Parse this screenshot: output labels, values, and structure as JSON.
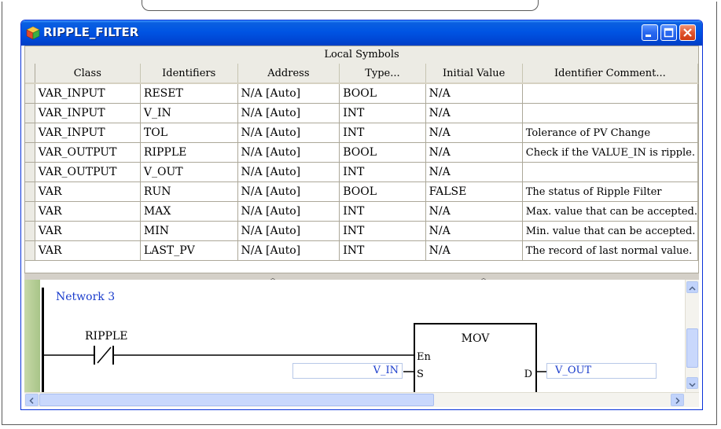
{
  "window": {
    "title": "RIPPLE_FILTER"
  },
  "symbols": {
    "caption": "Local Symbols",
    "columns": [
      "Class",
      "Identifiers",
      "Address",
      "Type...",
      "Initial Value",
      "Identifier Comment..."
    ],
    "rows": [
      [
        "VAR_INPUT",
        "RESET",
        "N/A [Auto]",
        "BOOL",
        "N/A",
        ""
      ],
      [
        "VAR_INPUT",
        "V_IN",
        "N/A [Auto]",
        "INT",
        "N/A",
        ""
      ],
      [
        "VAR_INPUT",
        "TOL",
        "N/A [Auto]",
        "INT",
        "N/A",
        "Tolerance of PV Change"
      ],
      [
        "VAR_OUTPUT",
        "RIPPLE",
        "N/A [Auto]",
        "BOOL",
        "N/A",
        "Check if the VALUE_IN is ripple."
      ],
      [
        "VAR_OUTPUT",
        "V_OUT",
        "N/A [Auto]",
        "INT",
        "N/A",
        ""
      ],
      [
        "VAR",
        "RUN",
        "N/A [Auto]",
        "BOOL",
        "FALSE",
        "The status of Ripple Filter"
      ],
      [
        "VAR",
        "MAX",
        "N/A [Auto]",
        "INT",
        "N/A",
        "Max. value that can be accepted."
      ],
      [
        "VAR",
        "MIN",
        "N/A [Auto]",
        "INT",
        "N/A",
        "Min. value that can be accepted."
      ],
      [
        "VAR",
        "LAST_PV",
        "N/A [Auto]",
        "INT",
        "N/A",
        "The record of last normal value."
      ]
    ]
  },
  "ladder": {
    "network_label": "Network 3",
    "contact_label": "RIPPLE",
    "block_name": "MOV",
    "pin_en": "En",
    "pin_s": "S",
    "pin_d": "D",
    "input_operand": "V_IN",
    "output_operand": "V_OUT"
  },
  "colors": {
    "titlebar": "#0054e3",
    "operand_text": "#1a3ccc",
    "gutter": "#a8c488"
  }
}
